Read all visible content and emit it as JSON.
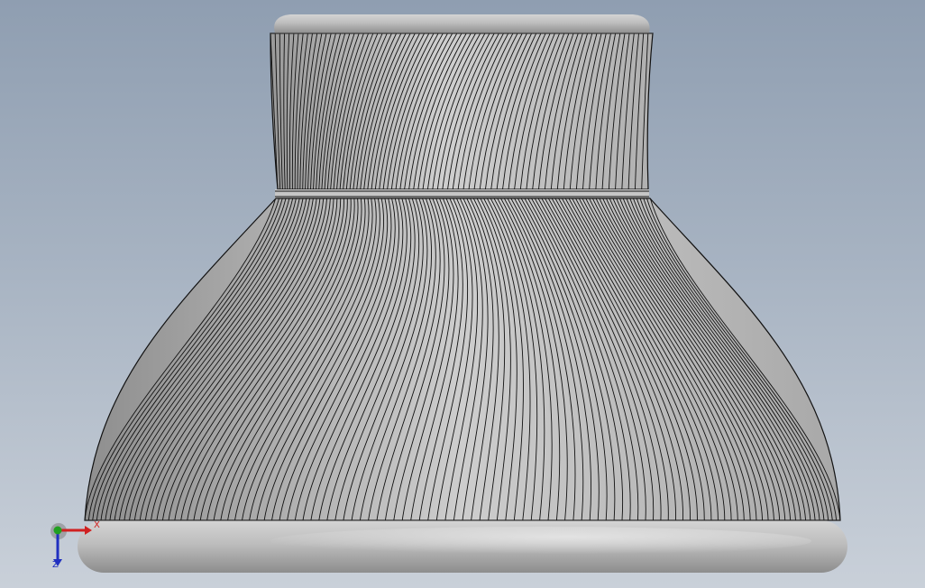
{
  "viewport": {
    "background_top": "#8f9eb1",
    "background_bottom": "#c9d0d9"
  },
  "model": {
    "part": "fluted-vase",
    "face_color": "#c0c0c0",
    "edge_color": "#111111",
    "top_flute_count": 82,
    "bottom_flute_count": 110
  },
  "triad": {
    "x_label": "X",
    "z_label": "Z",
    "x_color": "#d02020",
    "y_color": "#20a020",
    "z_color": "#2030c0"
  }
}
